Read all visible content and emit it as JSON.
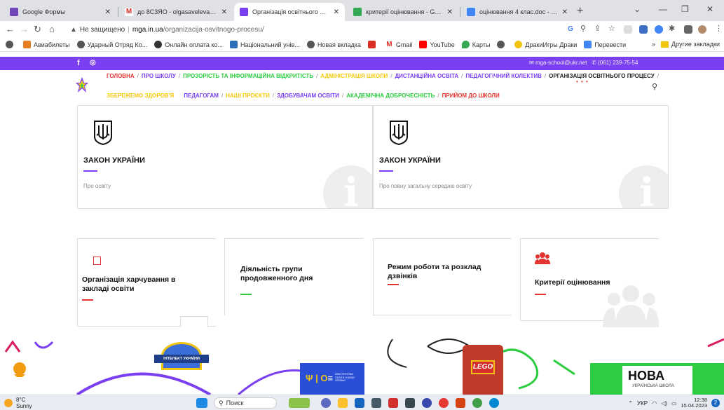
{
  "browser": {
    "tabs": [
      {
        "title": "Google Формы",
        "color": "#7248b9"
      },
      {
        "title": "до 8С3ЯО - olgasaveleva88@gm",
        "color": "#d93025"
      },
      {
        "title": "Організація освітнього процесу",
        "color": "#7b3ff2"
      },
      {
        "title": "критерії оцінювання - Google Д",
        "color": "#34a853"
      },
      {
        "title": "оцінювання 4 клас.doc - Google",
        "color": "#4285f4"
      }
    ],
    "new_tab": "+",
    "address": {
      "warning": "Не защищено",
      "host": "mga.in.ua",
      "path": "/organizacija-osvitnogo-procesu/"
    },
    "bookmarks": [
      {
        "label": "Авиабилеты",
        "color": "#e67e22"
      },
      {
        "label": "Ударный Отряд Ко...",
        "color": "#555555"
      },
      {
        "label": "Онлайн оплата ко...",
        "color": "#333333"
      },
      {
        "label": "Національний унів...",
        "color": "#2c6fb7"
      },
      {
        "label": "Новая вкладка",
        "color": "#555555"
      },
      {
        "label": "",
        "color": "#d93025"
      },
      {
        "label": "Gmail",
        "color": "#d93025"
      },
      {
        "label": "YouTube",
        "color": "#ff0000"
      },
      {
        "label": "Карты",
        "color": "#34a853"
      },
      {
        "label": "",
        "color": "#555555"
      },
      {
        "label": "ДракиИгры Драки",
        "color": "#f1c40f"
      },
      {
        "label": "Перевести",
        "color": "#4285f4"
      }
    ],
    "bookmarks_more": "»",
    "other_bookmarks": "Другие закладки"
  },
  "site": {
    "contact_email": "mga-school@ukr.net",
    "contact_phone": "(061) 239-75-54",
    "nav_row1": [
      {
        "label": "ГОЛОВНА",
        "color": "#e3342f"
      },
      {
        "label": "ПРО ШКОЛУ",
        "color": "#7b3ff2"
      },
      {
        "label": "ПРОЗОРІСТЬ ТА ІНФОРМАЦІЙНА ВІДКРИТІСТЬ",
        "color": "#2ecc40"
      },
      {
        "label": "АДМІНІСТРАЦІЯ ШКОЛИ",
        "color": "#f6c90e"
      },
      {
        "label": "ДИСТАНЦІЙНА ОСВІТА",
        "color": "#7b3ff2"
      },
      {
        "label": "ПЕДАГОГІЧНИЙ КОЛЕКТИВ",
        "color": "#7b3ff2"
      },
      {
        "label": "ОРГАНІЗАЦІЯ ОСВІТНЬОГО ПРОЦЕСУ",
        "color": "#222222"
      }
    ],
    "nav_row2": [
      {
        "label": "ЗБЕРЕЖЕМО ЗДОРОВ'Я",
        "color": "#f6c90e"
      },
      {
        "label": "ПЕДАГОГАМ",
        "color": "#7b3ff2"
      },
      {
        "label": "НАШІ ПРОЄКТИ",
        "color": "#f6c90e"
      },
      {
        "label": "ЗДОБУВАЧАМ ОСВІТИ",
        "color": "#7b3ff2"
      },
      {
        "label": "АКАДЕМІЧНА ДОБРОЧЕСНІСТЬ",
        "color": "#2ecc40"
      },
      {
        "label": "ПРИЙОМ ДО ШКОЛИ",
        "color": "#e3342f"
      }
    ],
    "law_cards": [
      {
        "title": "ЗАКОН УКРАЇНИ",
        "subtitle": "Про освіту"
      },
      {
        "title": "ЗАКОН УКРАЇНИ",
        "subtitle": "Про повну загальну середню освіту"
      }
    ],
    "feature_cards": [
      {
        "title": "Організація харчування в закладі освіти"
      },
      {
        "title": "Діяльність групи продовженного дня"
      },
      {
        "title": "Режим роботи та розклад дзвінків"
      },
      {
        "title": "Критерії оцінювання"
      }
    ],
    "banner": {
      "intellect_text": "ІНТЕЛЕКТ УКРАЇНИ",
      "ministry_text": "МІНІСТЕРСТВО ОСВІТИ І НАУКИ УКРАЇНИ",
      "lego_text": "LEGO",
      "nova_text": "НОВА",
      "nova_sub": "УКРАЇНСЬКА ШКОЛА"
    }
  },
  "taskbar": {
    "temperature": "8°C",
    "weather": "Sunny",
    "search": "Поиск",
    "lang": "УКР",
    "time": "12:38",
    "date": "15.04.2023",
    "notifications": "2"
  }
}
